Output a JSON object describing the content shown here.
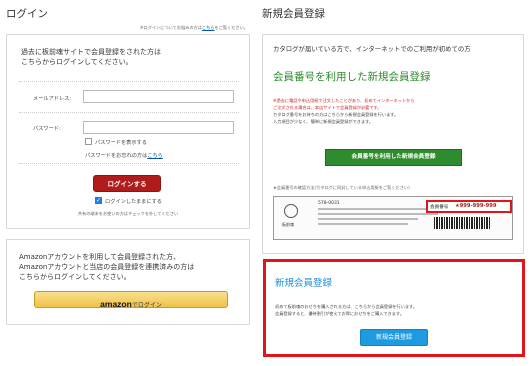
{
  "login": {
    "title": "ログイン",
    "note_text": "※ログインについてお悩みの方は",
    "note_link": "こちら",
    "note_tail": "をご覧ください。",
    "intro_line1": "過去に板前魂サイトで会員登録をされた方は",
    "intro_line2": "こちらからログインしてください。",
    "email_label": "メールアドレス:",
    "email_value": "",
    "password_label": "パスワード:",
    "password_value": "",
    "show_password_label": "パスワードを表示する",
    "forgot_text": "パスワードをお忘れの方は",
    "forgot_link": "こちら",
    "login_button": "ログインする",
    "remember_label": "ログインしたままにする",
    "remember_note": "共有の端末をお使いの方はチェックを外してください"
  },
  "amazon": {
    "line1": "Amazonアカウントを利用して会員登録された方、",
    "line2": "Amazonアカウントと当店の会員登録を連携済みの方は",
    "line3": "こちらからログインしてください。",
    "button_brand": "amazon",
    "button_text": "でログイン"
  },
  "register": {
    "title": "新規会員登録",
    "catalog_intro": "カタログが届いている方で、インターネットでのご利用が初めての方",
    "catalog_heading": "会員番号を利用した新規会員登録",
    "catalog_red_line1": "※過去に電話や申込用紙で注文したことがあり、初めてインターネットから",
    "catalog_red_line2": "ご注文される場合は、本店サイトで会員登録が必要です。",
    "catalog_line3": "カタログ番号をお持ちの方はこちらから新規会員登録を行います。",
    "catalog_line4": "入力項目が少なく、簡単に新規会員登録ができます。",
    "catalog_button": "会員番号を利用した新規会員登録",
    "member_no_note": "★会員番号の確認方法(カタログに同封している申込用紙をご覧ください)",
    "sample_postal": "578-0031",
    "sample_brand": "板前魂",
    "sample_member_label": "会員番号",
    "sample_member_value": "★999-999-999",
    "new_heading": "新規会員登録",
    "new_line1": "初めて板前魂のおせちを購入される方は、こちらから会員登録を行います。",
    "new_line2": "会員登録すると、優待割引が使えてお得におせちをご購入できます。",
    "new_button": "新規会員登録"
  },
  "colors": {
    "accent_red": "#b01c1c",
    "highlight_red": "#e0141a",
    "green": "#2e8b2e",
    "blue_heading": "#1e8fd6",
    "blue_button": "#1e9be0",
    "amazon_gold": "#efc248"
  }
}
